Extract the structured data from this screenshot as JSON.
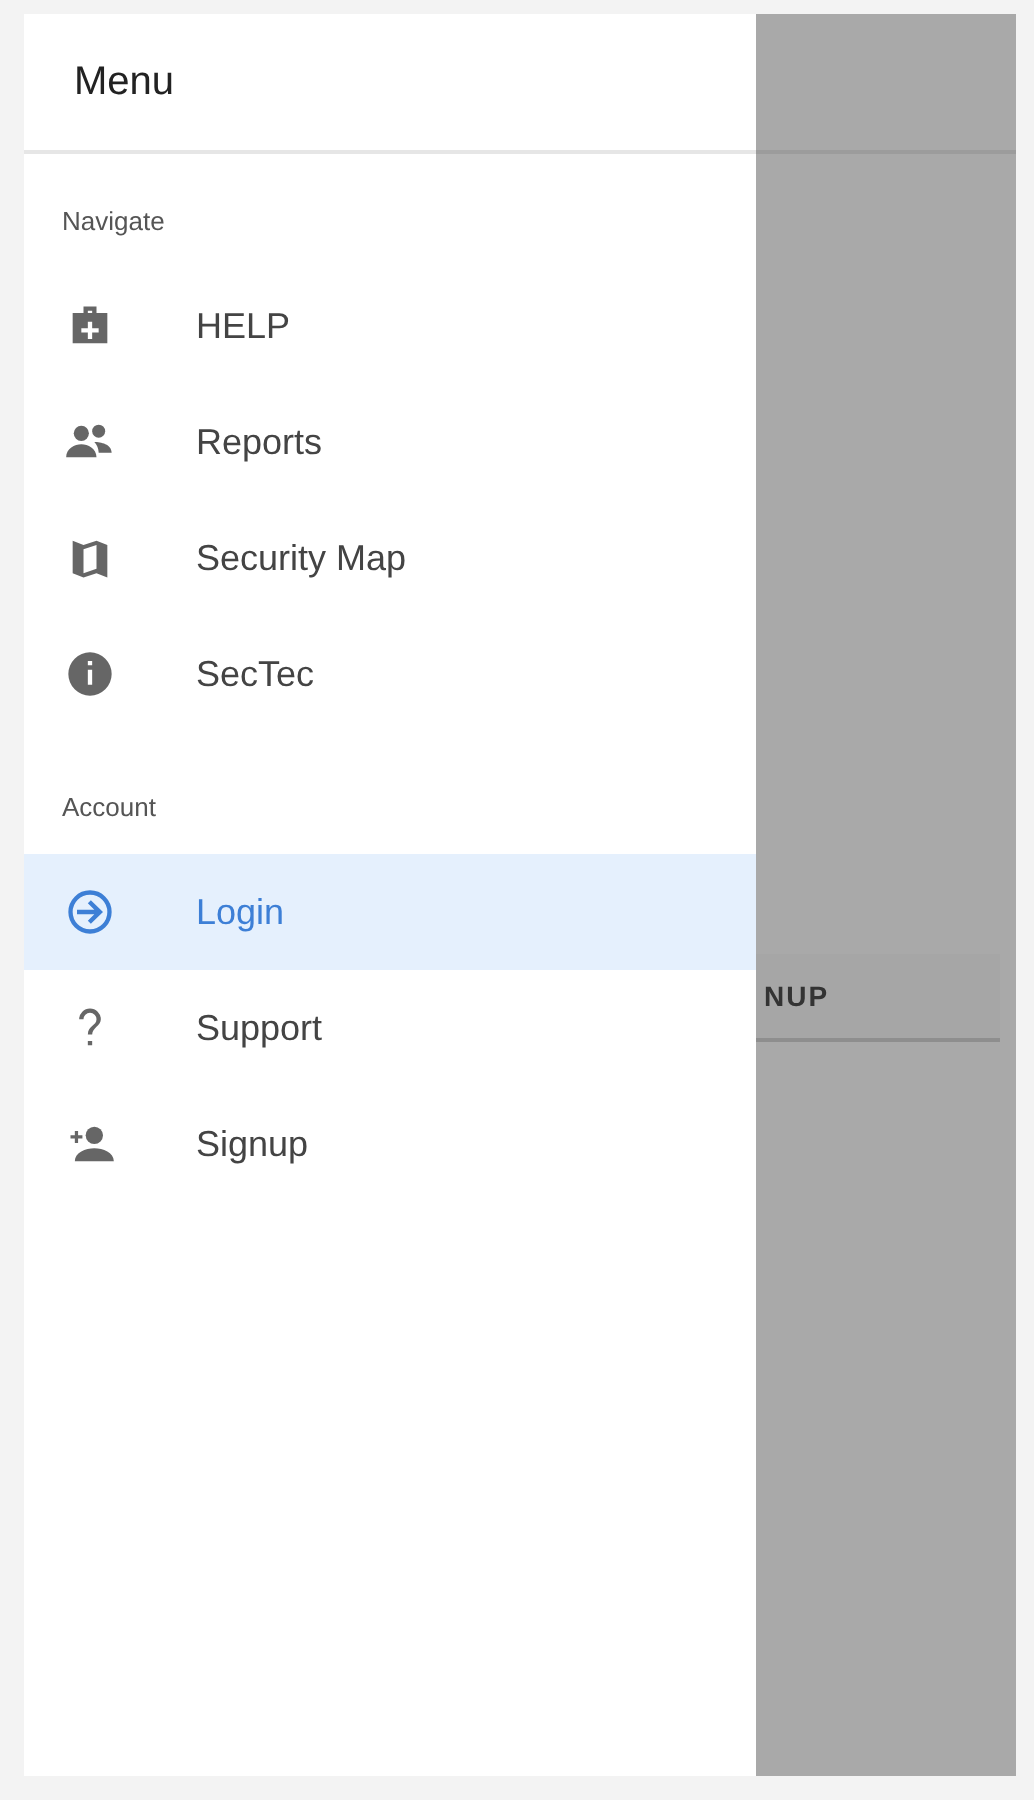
{
  "drawer": {
    "title": "Menu",
    "sections": [
      {
        "heading": "Navigate",
        "items": [
          {
            "label": "HELP",
            "selected": false
          },
          {
            "label": "Reports",
            "selected": false
          },
          {
            "label": "Security Map",
            "selected": false
          },
          {
            "label": "SecTec",
            "selected": false
          }
        ]
      },
      {
        "heading": "Account",
        "items": [
          {
            "label": "Login",
            "selected": true
          },
          {
            "label": "Support",
            "selected": false
          },
          {
            "label": "Signup",
            "selected": false
          }
        ]
      }
    ]
  },
  "background": {
    "button": "NUP"
  }
}
